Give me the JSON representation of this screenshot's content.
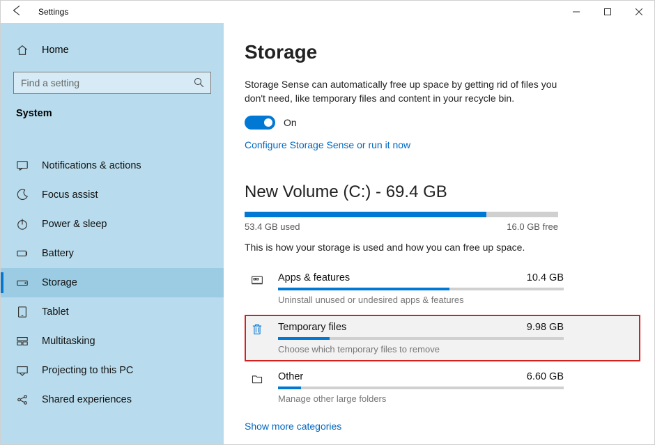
{
  "window": {
    "title": "Settings"
  },
  "sidebar": {
    "home": "Home",
    "search_placeholder": "Find a setting",
    "section": "System",
    "items": [
      {
        "label": "Notifications & actions",
        "icon": "message-icon"
      },
      {
        "label": "Focus assist",
        "icon": "moon-icon"
      },
      {
        "label": "Power & sleep",
        "icon": "power-icon"
      },
      {
        "label": "Battery",
        "icon": "battery-icon"
      },
      {
        "label": "Storage",
        "icon": "drive-icon",
        "active": true
      },
      {
        "label": "Tablet",
        "icon": "tablet-icon"
      },
      {
        "label": "Multitasking",
        "icon": "multitask-icon"
      },
      {
        "label": "Projecting to this PC",
        "icon": "project-icon"
      },
      {
        "label": "Shared experiences",
        "icon": "share-icon"
      }
    ]
  },
  "main": {
    "title": "Storage",
    "description": "Storage Sense can automatically free up space by getting rid of files you don't need, like temporary files and content in your recycle bin.",
    "toggle_state": "On",
    "link_configure": "Configure Storage Sense or run it now",
    "volume": {
      "title": "New Volume (C:) - 69.4 GB",
      "used_label": "53.4 GB used",
      "free_label": "16.0 GB free",
      "used_pct": 77,
      "howtext": "This is how your storage is used and how you can free up space."
    },
    "categories": [
      {
        "name": "Apps & features",
        "size": "10.4 GB",
        "sub": "Uninstall unused or undesired apps & features",
        "pct": 60,
        "icon": "apps-icon"
      },
      {
        "name": "Temporary files",
        "size": "9.98 GB",
        "sub": "Choose which temporary files to remove",
        "pct": 18,
        "icon": "trash-icon",
        "highlight": true
      },
      {
        "name": "Other",
        "size": "6.60 GB",
        "sub": "Manage other large folders",
        "pct": 8,
        "icon": "folder-icon"
      }
    ],
    "show_more": "Show more categories"
  }
}
